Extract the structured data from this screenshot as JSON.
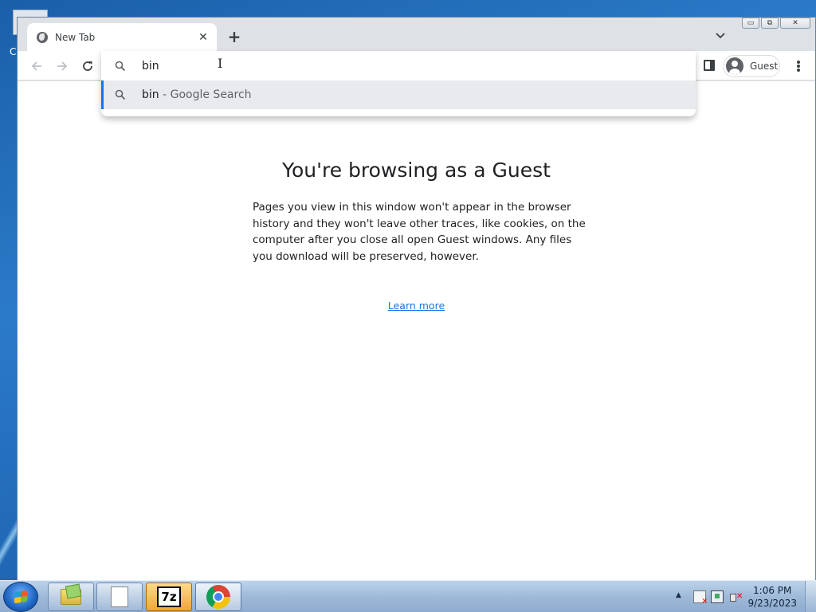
{
  "desktop": {
    "partial_icon_letter": "C"
  },
  "window": {
    "caption": {
      "minimize": "▭",
      "restore": "⧉",
      "close": "✕"
    }
  },
  "tabs": [
    {
      "title": "New Tab",
      "favicon": "globe-icon",
      "close": "✕"
    }
  ],
  "tabstrip": {
    "new_tab": "+",
    "tab_search": "chevron-down-icon"
  },
  "toolbar": {
    "back": "arrow-left-icon",
    "forward": "arrow-right-icon",
    "reload": "reload-icon",
    "side_panel": "side-panel-icon",
    "profile_name": "Guest",
    "menu": "kebab-menu-icon"
  },
  "omnibox": {
    "value": "bin",
    "suggestions": [
      {
        "query": "bin",
        "description": " - Google Search",
        "icon": "search-icon"
      }
    ]
  },
  "page": {
    "title": "You're browsing as a Guest",
    "body": "Pages you view in this window won't appear in the browser history and they won't leave other traces, like cookies, on the computer after you close all open Guest windows. Any files you download will be preserved, however.",
    "learn_more": "Learn more",
    "link_color": "#1a73e8"
  },
  "taskbar": {
    "items": [
      {
        "name": "windows-explorer",
        "label": ""
      },
      {
        "name": "notepad",
        "label": ""
      },
      {
        "name": "7-zip",
        "label": "7z"
      },
      {
        "name": "google-chrome",
        "label": ""
      }
    ],
    "clock": {
      "time": "1:06 PM",
      "date": "9/23/2023"
    }
  }
}
